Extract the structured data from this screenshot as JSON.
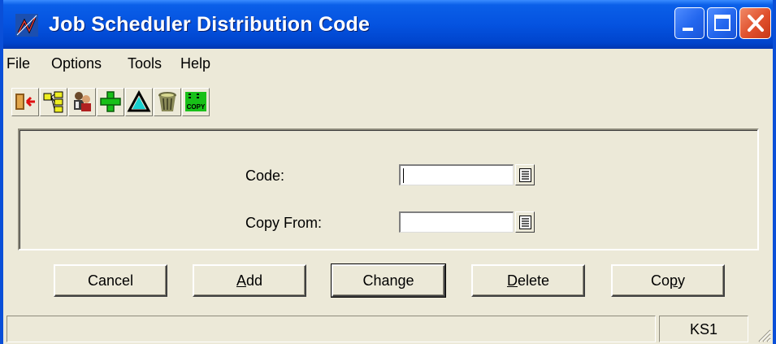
{
  "window": {
    "title": "Job Scheduler Distribution Code",
    "icon": "app-logo-icon",
    "controls": [
      "minimize-icon",
      "maximize-icon",
      "close-icon"
    ]
  },
  "menu": {
    "file": "File",
    "options": "Options",
    "tools": "Tools",
    "help": "Help"
  },
  "toolbar": {
    "icons": [
      "exit-icon",
      "tree-view-icon",
      "users-icon",
      "add-icon",
      "change-icon",
      "delete-icon",
      "copy-icon"
    ],
    "copy_icon_text": "COPY"
  },
  "form": {
    "code_label": "Code:",
    "code_value": "",
    "copy_from_label": "Copy From:",
    "copy_from_value": ""
  },
  "buttons": {
    "cancel": "Cancel",
    "add_mnemonic": "A",
    "add_rest": "dd",
    "change": "Change",
    "delete_mnemonic": "D",
    "delete_rest": "elete",
    "copy_pre": "Co",
    "copy_mnemonic": "p",
    "copy_post": "y"
  },
  "status": {
    "main": "",
    "right": "KS1"
  },
  "colors": {
    "titlebar": "#0553e0",
    "face": "#ece9d8",
    "close": "#e0502c"
  }
}
